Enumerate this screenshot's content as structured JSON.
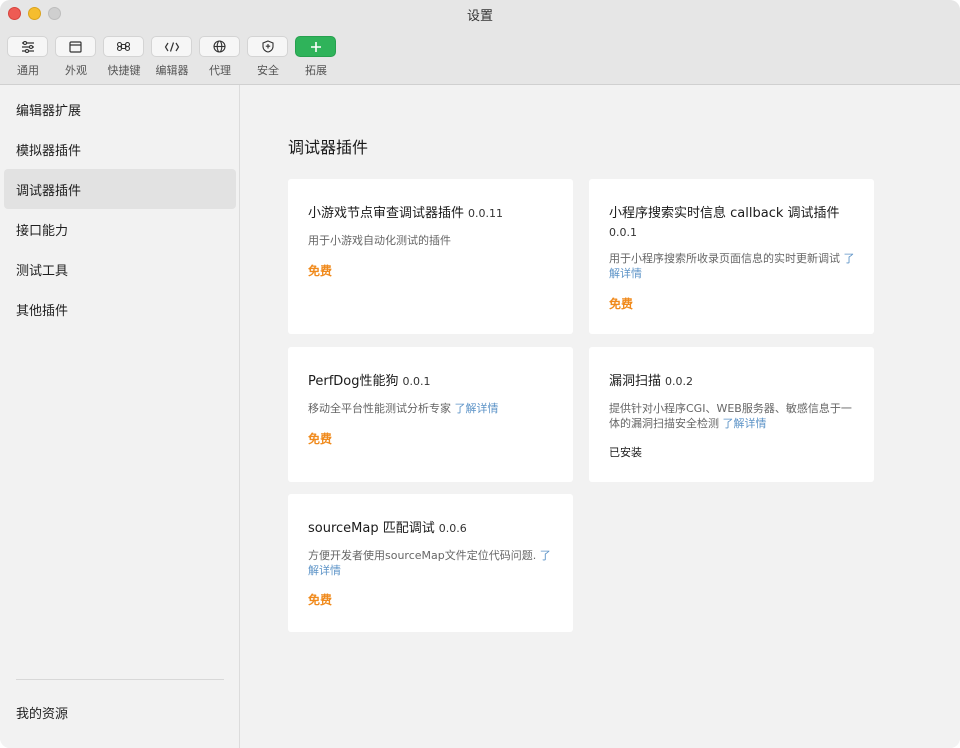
{
  "window": {
    "title": "设置"
  },
  "toolbar": [
    {
      "label": "通用",
      "icon": "sliders-icon"
    },
    {
      "label": "外观",
      "icon": "window-icon"
    },
    {
      "label": "快捷键",
      "icon": "command-icon"
    },
    {
      "label": "编辑器",
      "icon": "code-icon"
    },
    {
      "label": "代理",
      "icon": "globe-icon"
    },
    {
      "label": "安全",
      "icon": "shield-icon"
    },
    {
      "label": "拓展",
      "icon": "plus-icon"
    }
  ],
  "sidebar": {
    "items": [
      {
        "label": "编辑器扩展"
      },
      {
        "label": "模拟器插件"
      },
      {
        "label": "调试器插件",
        "active": true
      },
      {
        "label": "接口能力"
      },
      {
        "label": "测试工具"
      },
      {
        "label": "其他插件"
      }
    ],
    "footer": "我的资源"
  },
  "main": {
    "title": "调试器插件",
    "plugins": [
      {
        "name": "小游戏节点审查调试器插件",
        "version": "0.0.11",
        "desc": "用于小游戏自动化测试的插件",
        "link": "",
        "status": "免费"
      },
      {
        "name": "小程序搜索实时信息 callback 调试插件",
        "version": "0.0.1",
        "desc": "用于小程序搜索所收录页面信息的实时更新调试",
        "link": "了解详情",
        "status": "免费"
      },
      {
        "name": "PerfDog性能狗",
        "version": "0.0.1",
        "desc": "移动全平台性能测试分析专家",
        "link": "了解详情",
        "status": "免费"
      },
      {
        "name": "漏洞扫描",
        "version": "0.0.2",
        "desc": "提供针对小程序CGI、WEB服务器、敏感信息于一体的漏洞扫描安全检测",
        "link": "了解详情",
        "status": "已安装"
      },
      {
        "name": "sourceMap 匹配调试",
        "version": "0.0.6",
        "desc": "方便开发者使用sourceMap文件定位代码问题.",
        "link": "了解详情",
        "status": "免费"
      }
    ]
  },
  "colors": {
    "accent_green": "#2fb35a",
    "price_orange": "#f08a1c",
    "link_blue": "#5c93c7"
  }
}
